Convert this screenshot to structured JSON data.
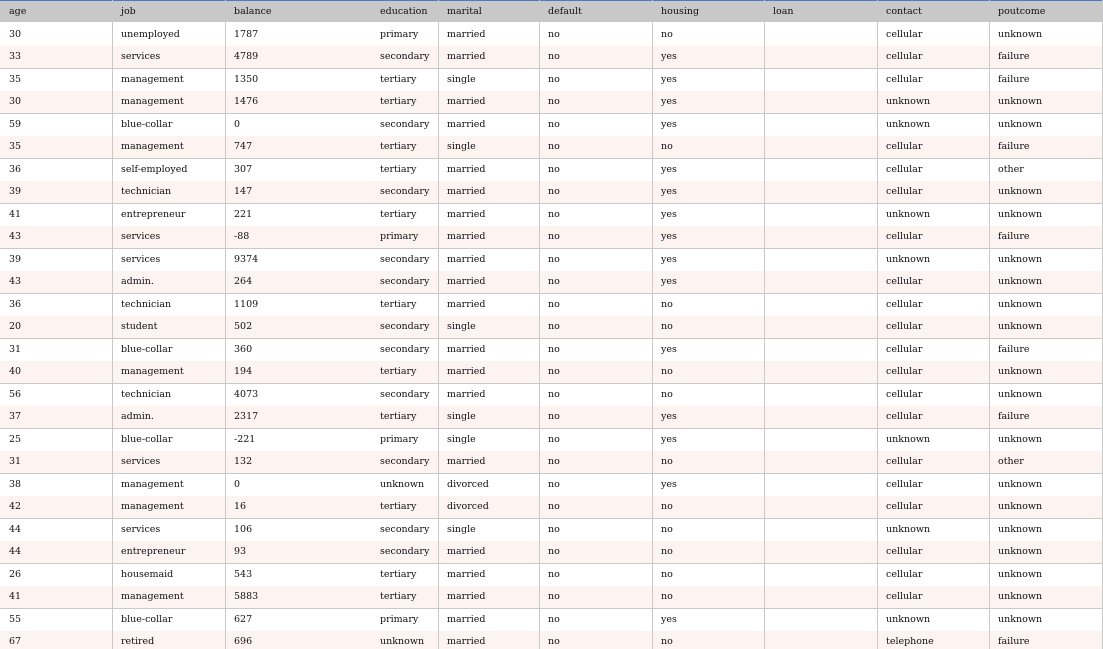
{
  "columns": [
    "age",
    "job",
    "balance",
    "education",
    "marital",
    "default",
    "housing",
    "loan",
    "contact",
    "poutcome"
  ],
  "rows": [
    [
      "30",
      "unemployed",
      "1787",
      "primary",
      "married",
      "no",
      "no",
      "",
      "cellular",
      "unknown"
    ],
    [
      "33",
      "services",
      "4789",
      "secondary",
      "married",
      "no",
      "yes",
      "",
      "cellular",
      "failure"
    ],
    [
      "35",
      "management",
      "1350",
      "tertiary",
      "single",
      "no",
      "yes",
      "",
      "cellular",
      "failure"
    ],
    [
      "30",
      "management",
      "1476",
      "tertiary",
      "married",
      "no",
      "yes",
      "",
      "unknown",
      "unknown"
    ],
    [
      "59",
      "blue-collar",
      "0",
      "secondary",
      "married",
      "no",
      "yes",
      "",
      "unknown",
      "unknown"
    ],
    [
      "35",
      "management",
      "747",
      "tertiary",
      "single",
      "no",
      "no",
      "",
      "cellular",
      "failure"
    ],
    [
      "36",
      "self-employed",
      "307",
      "tertiary",
      "married",
      "no",
      "yes",
      "",
      "cellular",
      "other"
    ],
    [
      "39",
      "technician",
      "147",
      "secondary",
      "married",
      "no",
      "yes",
      "",
      "cellular",
      "unknown"
    ],
    [
      "41",
      "entrepreneur",
      "221",
      "tertiary",
      "married",
      "no",
      "yes",
      "",
      "unknown",
      "unknown"
    ],
    [
      "43",
      "services",
      "-88",
      "primary",
      "married",
      "no",
      "yes",
      "",
      "cellular",
      "failure"
    ],
    [
      "39",
      "services",
      "9374",
      "secondary",
      "married",
      "no",
      "yes",
      "",
      "unknown",
      "unknown"
    ],
    [
      "43",
      "admin.",
      "264",
      "secondary",
      "married",
      "no",
      "yes",
      "",
      "cellular",
      "unknown"
    ],
    [
      "36",
      "technician",
      "1109",
      "tertiary",
      "married",
      "no",
      "no",
      "",
      "cellular",
      "unknown"
    ],
    [
      "20",
      "student",
      "502",
      "secondary",
      "single",
      "no",
      "no",
      "",
      "cellular",
      "unknown"
    ],
    [
      "31",
      "blue-collar",
      "360",
      "secondary",
      "married",
      "no",
      "yes",
      "",
      "cellular",
      "failure"
    ],
    [
      "40",
      "management",
      "194",
      "tertiary",
      "married",
      "no",
      "no",
      "",
      "cellular",
      "unknown"
    ],
    [
      "56",
      "technician",
      "4073",
      "secondary",
      "married",
      "no",
      "no",
      "",
      "cellular",
      "unknown"
    ],
    [
      "37",
      "admin.",
      "2317",
      "tertiary",
      "single",
      "no",
      "yes",
      "",
      "cellular",
      "failure"
    ],
    [
      "25",
      "blue-collar",
      "-221",
      "primary",
      "single",
      "no",
      "yes",
      "",
      "unknown",
      "unknown"
    ],
    [
      "31",
      "services",
      "132",
      "secondary",
      "married",
      "no",
      "no",
      "",
      "cellular",
      "other"
    ],
    [
      "38",
      "management",
      "0",
      "unknown",
      "divorced",
      "no",
      "yes",
      "",
      "cellular",
      "unknown"
    ],
    [
      "42",
      "management",
      "16",
      "tertiary",
      "divorced",
      "no",
      "no",
      "",
      "cellular",
      "unknown"
    ],
    [
      "44",
      "services",
      "106",
      "secondary",
      "single",
      "no",
      "no",
      "",
      "unknown",
      "unknown"
    ],
    [
      "44",
      "entrepreneur",
      "93",
      "secondary",
      "married",
      "no",
      "no",
      "",
      "cellular",
      "unknown"
    ],
    [
      "26",
      "housemaid",
      "543",
      "tertiary",
      "married",
      "no",
      "no",
      "",
      "cellular",
      "unknown"
    ],
    [
      "41",
      "management",
      "5883",
      "tertiary",
      "married",
      "no",
      "no",
      "",
      "cellular",
      "unknown"
    ],
    [
      "55",
      "blue-collar",
      "627",
      "primary",
      "married",
      "no",
      "yes",
      "",
      "unknown",
      "unknown"
    ],
    [
      "67",
      "retired",
      "696",
      "unknown",
      "married",
      "no",
      "no",
      "",
      "telephone",
      "failure"
    ]
  ]
}
